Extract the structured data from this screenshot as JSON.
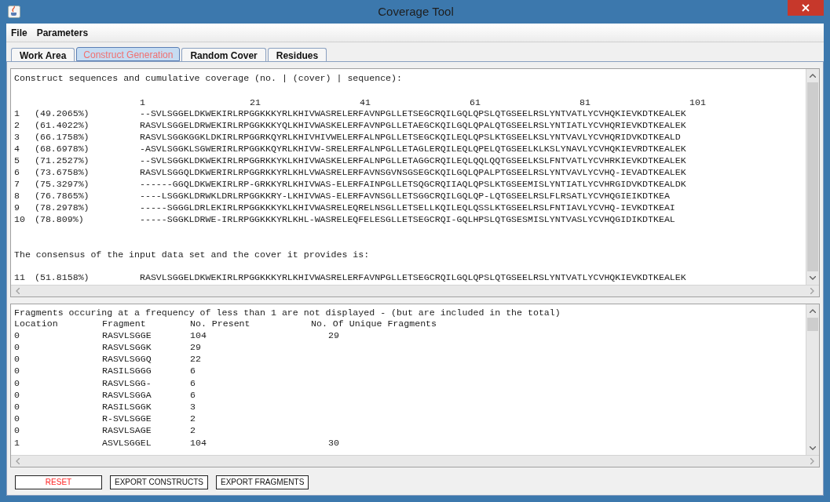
{
  "window": {
    "title": "Coverage Tool"
  },
  "menu": [
    "File",
    "Parameters"
  ],
  "tabs": [
    {
      "label": "Work Area",
      "selected": false
    },
    {
      "label": "Construct Generation",
      "selected": true
    },
    {
      "label": "Random Cover",
      "selected": false
    },
    {
      "label": "Residues",
      "selected": false
    }
  ],
  "constructs": {
    "header": "Construct sequences and cumulative coverage (no. | (cover) | sequence):",
    "ruler": [
      "1",
      "21",
      "41",
      "61",
      "81",
      "101"
    ],
    "rows": [
      {
        "number": "1",
        "cover": "(49.2065%)",
        "sequence": "--SVLSGGELDKWEKIRLRPGGKKKYRLKHIVWASRELERFAVNPGLLETSEGCRQILGQLQPSLQTGSEELRSLYNTVATLYCVHQKIEVKDTKEALEK"
      },
      {
        "number": "2",
        "cover": "(61.4022%)",
        "sequence": "RASVLSGGELDRWEKIRLRPGGKKKYQLKHIVWASKELERFAVNPGLLETAEGCKQILGQLQPALQTGSEELRSLYNTIATLYCVHQRIEVKDTKEALEK"
      },
      {
        "number": "3",
        "cover": "(66.1758%)",
        "sequence": "RASVLSGGKGGKLDKIRLRPGGRKQYRLKHIVHIVWELERFALNPGLLETSEGCKQILEQLQPSLKTGSEELKSLYNTVAVLYCVHQRIDVKDTKEALD"
      },
      {
        "number": "4",
        "cover": "(68.6978%)",
        "sequence": "-ASVLSGGKLSGWERIRLRPGGKKQYRLKHIVW-SRELERFALNPGLLETAGLERQILEQLQPELQTGSEELKLKSLYNAVLYCVHQKIEVRDTKEALEK"
      },
      {
        "number": "5",
        "cover": "(71.2527%)",
        "sequence": "--SVLSGGKLDKWEKIRLRPGGRKKYKLKHIVWASKELERFALNPGLLETAGGCRQILEQLQQLQQTGSEELKSLFNTVATLYCVHRKIEVKDTKEALEK"
      },
      {
        "number": "6",
        "cover": "(73.6758%)",
        "sequence": "RASVLSGGQLDKWERIRLRPGGRKKYRLKHLVWASRELERFAVNSGVNSGSEGCKQILGQLQPALPTGSEELRSLYNTVAVLYCVHQ-IEVADTKEALEK"
      },
      {
        "number": "7",
        "cover": "(75.3297%)",
        "sequence": "------GGQLDKWEKIRLRP-GRKKYRLKHIVWAS-ELERFAINPGLLETSQGCRQIIAQLQPSLKTGSEEMISLYNTIATLYCVHRGIDVKDTKEALDK"
      },
      {
        "number": "8",
        "cover": "(76.7865%)",
        "sequence": "----LSGGKLDRWKLDRLRPGGKKRY-LKHIVWAS-ELERFAVNSGLLETSGGCRQILGQLQP-LQTGSEELRSLFLRSATLYCVHQGIEIKDTKEA"
      },
      {
        "number": "9",
        "cover": "(78.2978%)",
        "sequence": "-----SGGGLDRLEKIRLRPGGKKKYKLKHIVWASRELEQRELNSGLLETSELLKQILEQLQSSLKTGSEELRSLFNTIAVLYCVHQ-IEVKDTKEAI"
      },
      {
        "number": "10",
        "cover": "(78.809%)",
        "sequence": "-----SGGKLDRWE-IRLRPGGKKKYRLKHL-WASRELEQFELESGLLETSEGCRQI-GQLHPSLQTGSESMISLYNTVASLYCVHQGIDIKDTKEAL"
      }
    ],
    "consensus_header": "The consensus of the input data set and the cover it provides is:",
    "consensus": {
      "number": "11",
      "cover": "(51.8158%)",
      "sequence": "RASVLSGGELDKWEKIRLRPGGKKKYRLKHIVWASRELERFAVNPGLLETSEGCRQILGQLQPSLQTGSEELRSLYNTVATLYCVHQKIEVKDTKEALEK"
    }
  },
  "fragments": {
    "note": "Fragments occuring at a frequency of less than 1 are not displayed - (but are included in the total)",
    "columns": [
      "Location",
      "Fragment",
      "No. Present",
      "No. Of Unique Fragments"
    ],
    "rows": [
      [
        "0",
        "RASVLSGGE",
        "104",
        "29"
      ],
      [
        "0",
        "RASVLSGGK",
        "29",
        ""
      ],
      [
        "0",
        "RASVLSGGQ",
        "22",
        ""
      ],
      [
        "0",
        "RASILSGGG",
        "6",
        ""
      ],
      [
        "0",
        "RASVLSGG-",
        "6",
        ""
      ],
      [
        "0",
        "RASVLSGGA",
        "6",
        ""
      ],
      [
        "0",
        "RASILSGGK",
        "3",
        ""
      ],
      [
        "0",
        "R-SVLSGGE",
        "2",
        ""
      ],
      [
        "0",
        "RASVLSAGE",
        "2",
        ""
      ],
      [
        "1",
        "ASVLSGGEL",
        "104",
        "30"
      ]
    ]
  },
  "buttons": [
    {
      "label": "RESET",
      "kind": "reset"
    },
    {
      "label": "EXPORT CONSTRUCTS",
      "kind": "export"
    },
    {
      "label": "EXPORT FRAGMENTS",
      "kind": "export"
    }
  ]
}
